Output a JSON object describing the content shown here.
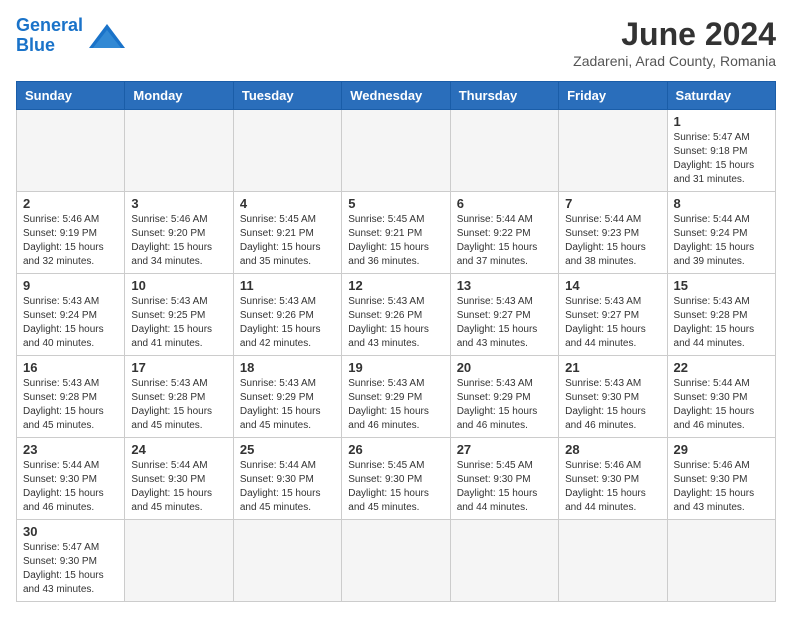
{
  "header": {
    "logo_line1": "General",
    "logo_line2": "Blue",
    "month_year": "June 2024",
    "location": "Zadareni, Arad County, Romania"
  },
  "weekdays": [
    "Sunday",
    "Monday",
    "Tuesday",
    "Wednesday",
    "Thursday",
    "Friday",
    "Saturday"
  ],
  "weeks": [
    [
      {
        "day": "",
        "info": ""
      },
      {
        "day": "",
        "info": ""
      },
      {
        "day": "",
        "info": ""
      },
      {
        "day": "",
        "info": ""
      },
      {
        "day": "",
        "info": ""
      },
      {
        "day": "",
        "info": ""
      },
      {
        "day": "1",
        "info": "Sunrise: 5:47 AM\nSunset: 9:18 PM\nDaylight: 15 hours\nand 31 minutes."
      }
    ],
    [
      {
        "day": "2",
        "info": "Sunrise: 5:46 AM\nSunset: 9:19 PM\nDaylight: 15 hours\nand 32 minutes."
      },
      {
        "day": "3",
        "info": "Sunrise: 5:46 AM\nSunset: 9:20 PM\nDaylight: 15 hours\nand 34 minutes."
      },
      {
        "day": "4",
        "info": "Sunrise: 5:45 AM\nSunset: 9:21 PM\nDaylight: 15 hours\nand 35 minutes."
      },
      {
        "day": "5",
        "info": "Sunrise: 5:45 AM\nSunset: 9:21 PM\nDaylight: 15 hours\nand 36 minutes."
      },
      {
        "day": "6",
        "info": "Sunrise: 5:44 AM\nSunset: 9:22 PM\nDaylight: 15 hours\nand 37 minutes."
      },
      {
        "day": "7",
        "info": "Sunrise: 5:44 AM\nSunset: 9:23 PM\nDaylight: 15 hours\nand 38 minutes."
      },
      {
        "day": "8",
        "info": "Sunrise: 5:44 AM\nSunset: 9:24 PM\nDaylight: 15 hours\nand 39 minutes."
      }
    ],
    [
      {
        "day": "9",
        "info": "Sunrise: 5:43 AM\nSunset: 9:24 PM\nDaylight: 15 hours\nand 40 minutes."
      },
      {
        "day": "10",
        "info": "Sunrise: 5:43 AM\nSunset: 9:25 PM\nDaylight: 15 hours\nand 41 minutes."
      },
      {
        "day": "11",
        "info": "Sunrise: 5:43 AM\nSunset: 9:26 PM\nDaylight: 15 hours\nand 42 minutes."
      },
      {
        "day": "12",
        "info": "Sunrise: 5:43 AM\nSunset: 9:26 PM\nDaylight: 15 hours\nand 43 minutes."
      },
      {
        "day": "13",
        "info": "Sunrise: 5:43 AM\nSunset: 9:27 PM\nDaylight: 15 hours\nand 43 minutes."
      },
      {
        "day": "14",
        "info": "Sunrise: 5:43 AM\nSunset: 9:27 PM\nDaylight: 15 hours\nand 44 minutes."
      },
      {
        "day": "15",
        "info": "Sunrise: 5:43 AM\nSunset: 9:28 PM\nDaylight: 15 hours\nand 44 minutes."
      }
    ],
    [
      {
        "day": "16",
        "info": "Sunrise: 5:43 AM\nSunset: 9:28 PM\nDaylight: 15 hours\nand 45 minutes."
      },
      {
        "day": "17",
        "info": "Sunrise: 5:43 AM\nSunset: 9:28 PM\nDaylight: 15 hours\nand 45 minutes."
      },
      {
        "day": "18",
        "info": "Sunrise: 5:43 AM\nSunset: 9:29 PM\nDaylight: 15 hours\nand 45 minutes."
      },
      {
        "day": "19",
        "info": "Sunrise: 5:43 AM\nSunset: 9:29 PM\nDaylight: 15 hours\nand 46 minutes."
      },
      {
        "day": "20",
        "info": "Sunrise: 5:43 AM\nSunset: 9:29 PM\nDaylight: 15 hours\nand 46 minutes."
      },
      {
        "day": "21",
        "info": "Sunrise: 5:43 AM\nSunset: 9:30 PM\nDaylight: 15 hours\nand 46 minutes."
      },
      {
        "day": "22",
        "info": "Sunrise: 5:44 AM\nSunset: 9:30 PM\nDaylight: 15 hours\nand 46 minutes."
      }
    ],
    [
      {
        "day": "23",
        "info": "Sunrise: 5:44 AM\nSunset: 9:30 PM\nDaylight: 15 hours\nand 46 minutes."
      },
      {
        "day": "24",
        "info": "Sunrise: 5:44 AM\nSunset: 9:30 PM\nDaylight: 15 hours\nand 45 minutes."
      },
      {
        "day": "25",
        "info": "Sunrise: 5:44 AM\nSunset: 9:30 PM\nDaylight: 15 hours\nand 45 minutes."
      },
      {
        "day": "26",
        "info": "Sunrise: 5:45 AM\nSunset: 9:30 PM\nDaylight: 15 hours\nand 45 minutes."
      },
      {
        "day": "27",
        "info": "Sunrise: 5:45 AM\nSunset: 9:30 PM\nDaylight: 15 hours\nand 44 minutes."
      },
      {
        "day": "28",
        "info": "Sunrise: 5:46 AM\nSunset: 9:30 PM\nDaylight: 15 hours\nand 44 minutes."
      },
      {
        "day": "29",
        "info": "Sunrise: 5:46 AM\nSunset: 9:30 PM\nDaylight: 15 hours\nand 43 minutes."
      }
    ],
    [
      {
        "day": "30",
        "info": "Sunrise: 5:47 AM\nSunset: 9:30 PM\nDaylight: 15 hours\nand 43 minutes."
      },
      {
        "day": "",
        "info": ""
      },
      {
        "day": "",
        "info": ""
      },
      {
        "day": "",
        "info": ""
      },
      {
        "day": "",
        "info": ""
      },
      {
        "day": "",
        "info": ""
      },
      {
        "day": "",
        "info": ""
      }
    ]
  ]
}
